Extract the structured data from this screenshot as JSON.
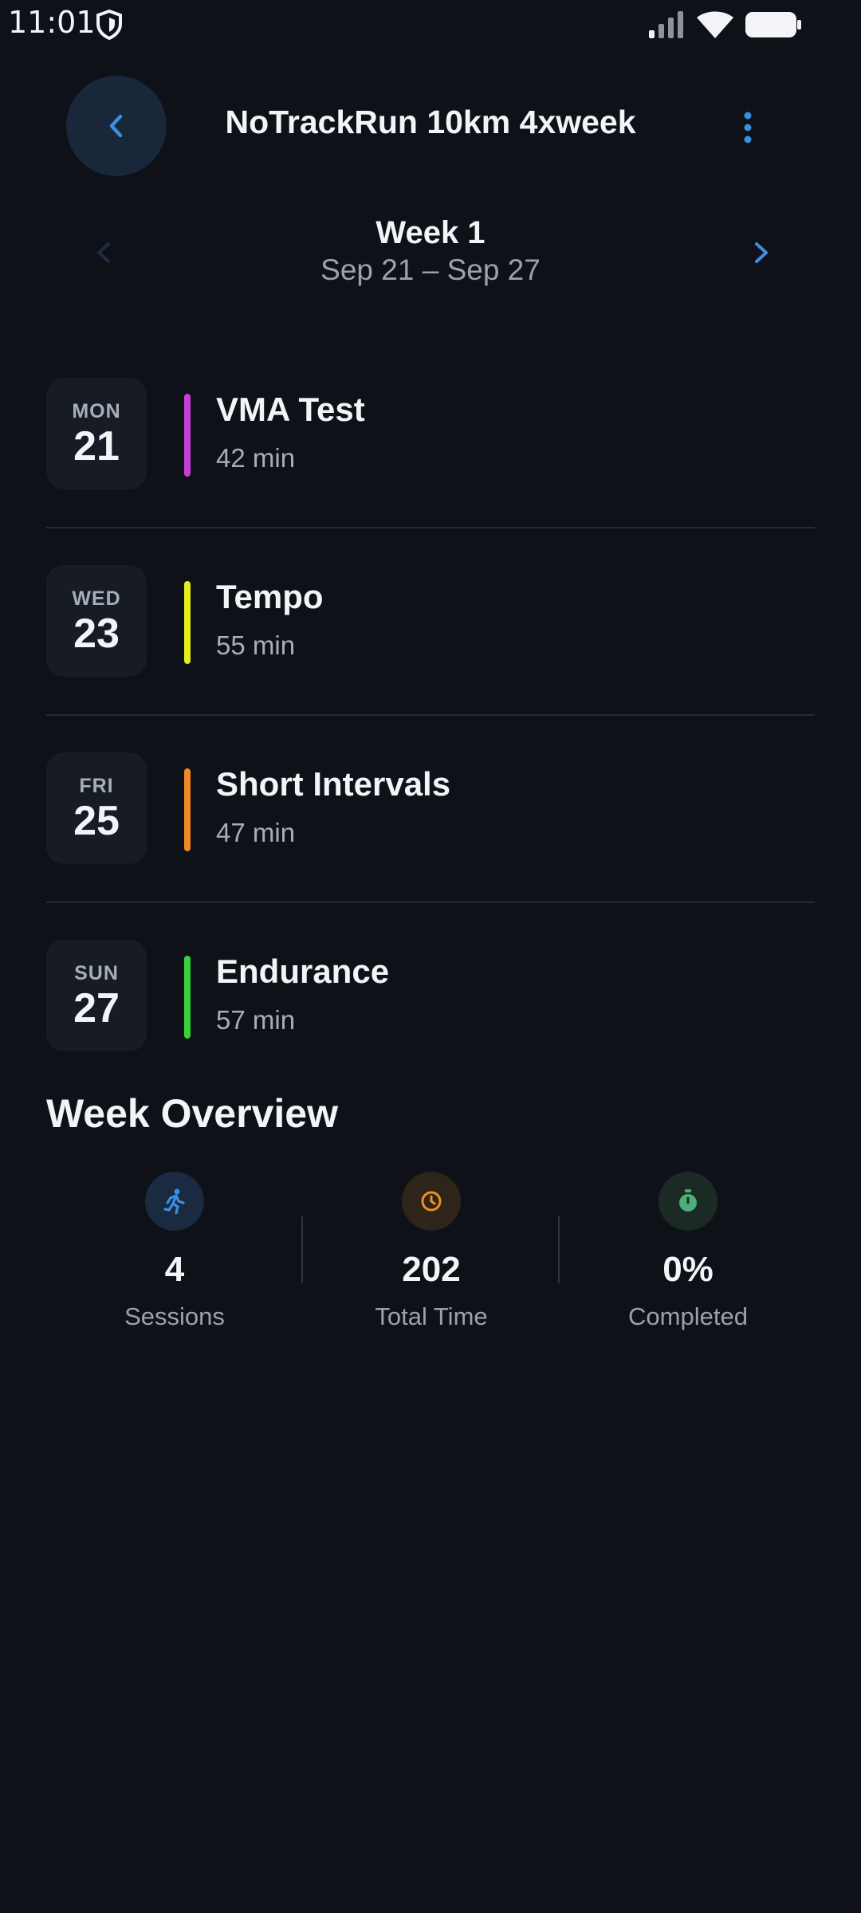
{
  "status_bar": {
    "time": "11:01"
  },
  "header": {
    "title": "NoTrackRun 10km 4xweek"
  },
  "week_nav": {
    "title": "Week 1",
    "range": "Sep 21 – Sep 27"
  },
  "sessions": [
    {
      "day": "MON",
      "date": "21",
      "title": "VMA Test",
      "duration": "42 min",
      "color": "#c63fd8"
    },
    {
      "day": "WED",
      "date": "23",
      "title": "Tempo",
      "duration": "55 min",
      "color": "#e6ee1c"
    },
    {
      "day": "FRI",
      "date": "25",
      "title": "Short Intervals",
      "duration": "47 min",
      "color": "#f08a24"
    },
    {
      "day": "SUN",
      "date": "27",
      "title": "Endurance",
      "duration": "57 min",
      "color": "#39d23a"
    }
  ],
  "overview": {
    "title": "Week Overview",
    "stats": [
      {
        "icon": "runner-icon",
        "value": "4",
        "label": "Sessions",
        "color": "#3d8ee0"
      },
      {
        "icon": "clock-icon",
        "value": "202",
        "label": "Total Time",
        "color": "#f0901e"
      },
      {
        "icon": "stopwatch-icon",
        "value": "0%",
        "label": "Completed",
        "color": "#4caf7a"
      }
    ]
  },
  "colors": {
    "accent": "#3d8ee0",
    "background": "#0e1118"
  }
}
